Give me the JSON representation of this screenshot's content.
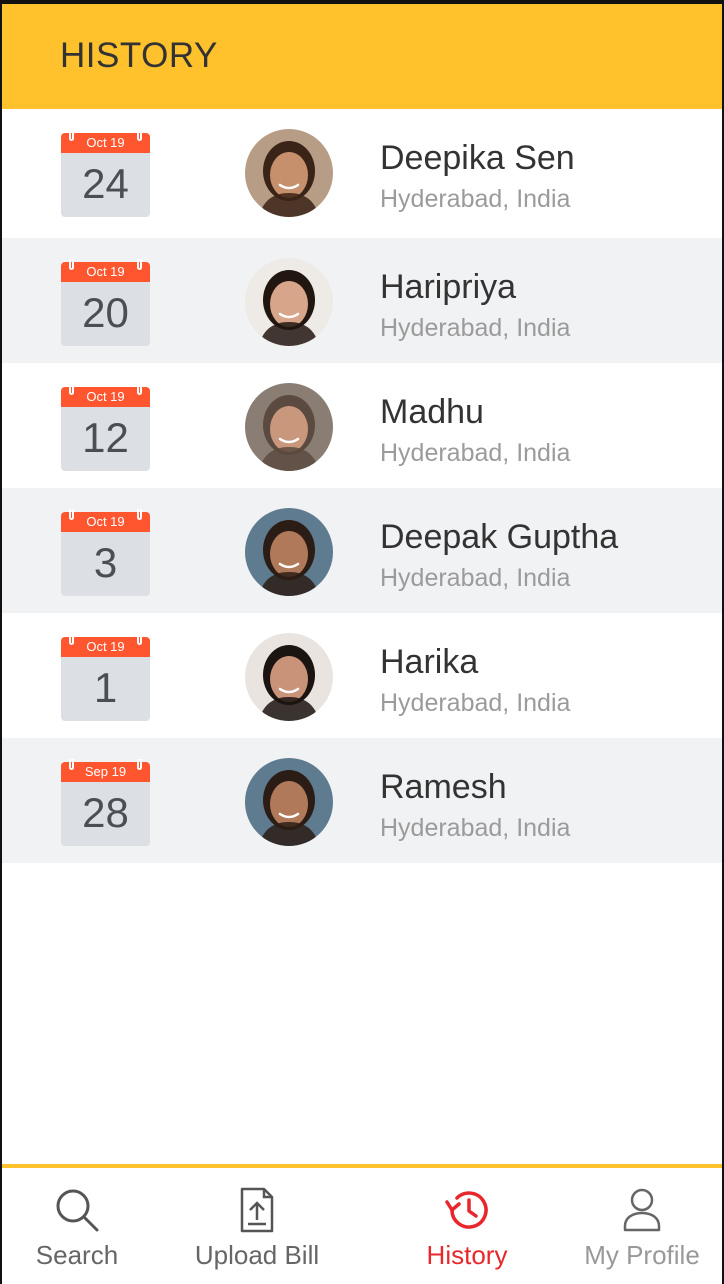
{
  "header": {
    "title": "HISTORY"
  },
  "history": [
    {
      "month": "Oct 19",
      "day": "24",
      "name": "Deepika Sen",
      "location": "Hyderabad, India",
      "avatar_skin": "#c7906c",
      "avatar_hair": "#3a2418",
      "avatar_bg": "#b89d86"
    },
    {
      "month": "Oct 19",
      "day": "20",
      "name": "Haripriya",
      "location": "Hyderabad, India",
      "avatar_skin": "#d7a589",
      "avatar_hair": "#221611",
      "avatar_bg": "#eeeae6"
    },
    {
      "month": "Oct 19",
      "day": "12",
      "name": "Madhu",
      "location": "Hyderabad, India",
      "avatar_skin": "#c8977c",
      "avatar_hair": "#5b4a3f",
      "avatar_bg": "#8a7d73"
    },
    {
      "month": "Oct 19",
      "day": "3",
      "name": "Deepak Guptha",
      "location": "Hyderabad, India",
      "avatar_skin": "#b07a5a",
      "avatar_hair": "#2b1d15",
      "avatar_bg": "#5f7b8f"
    },
    {
      "month": "Oct 19",
      "day": "1",
      "name": "Harika",
      "location": "Hyderabad, India",
      "avatar_skin": "#c9937a",
      "avatar_hair": "#1b1411",
      "avatar_bg": "#e9e4e0"
    },
    {
      "month": "Sep 19",
      "day": "28",
      "name": "Ramesh",
      "location": "Hyderabad, India",
      "avatar_skin": "#b07a5a",
      "avatar_hair": "#2b1d15",
      "avatar_bg": "#5f7b8f"
    }
  ],
  "tabs": [
    {
      "label": "Search",
      "icon": "search-icon"
    },
    {
      "label": "Upload Bill",
      "icon": "upload-bill-icon"
    },
    {
      "label": "History",
      "icon": "history-icon",
      "active": true
    },
    {
      "label": "My Profile",
      "icon": "profile-icon"
    }
  ],
  "colors": {
    "header_bg": "#ffc22d",
    "calendar_head": "#ff5630",
    "calendar_body": "#dcdfe3",
    "active_tab": "#e8272c",
    "alt_row": "#f1f2f4"
  }
}
